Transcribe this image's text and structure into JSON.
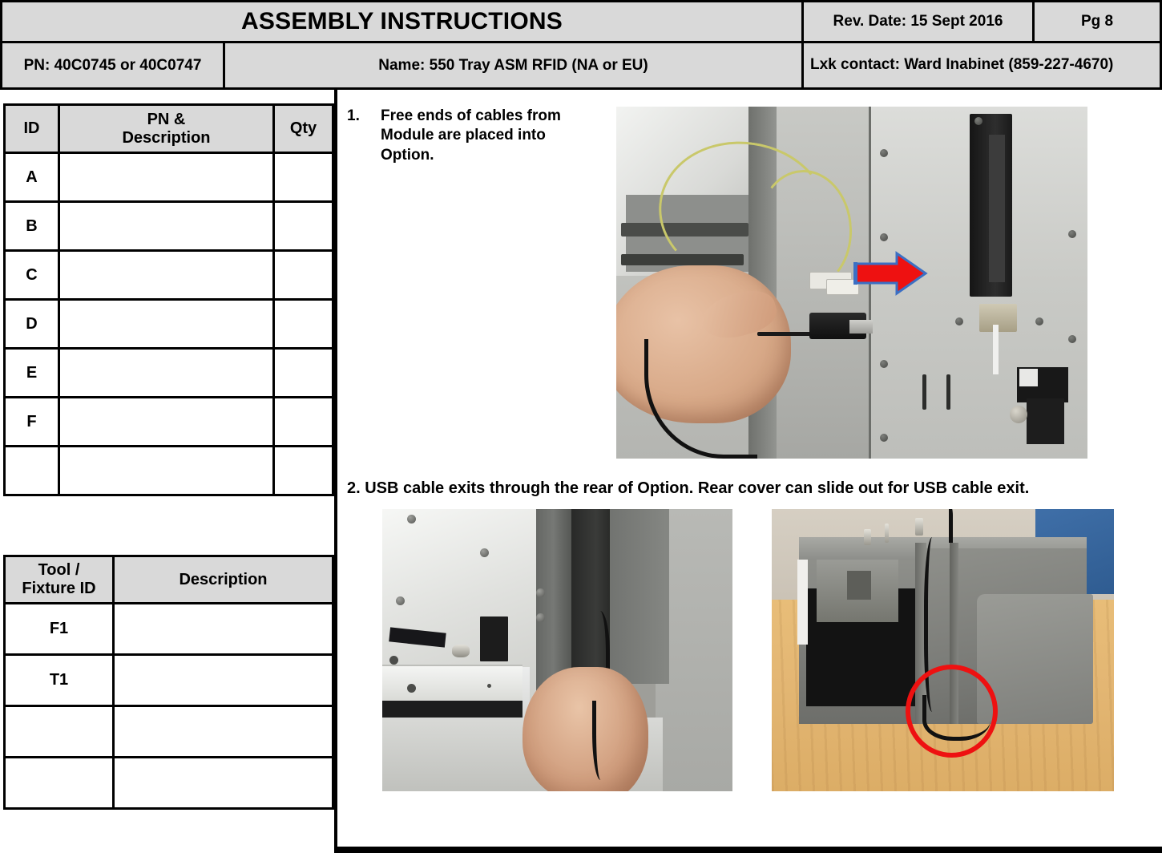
{
  "header": {
    "title": "ASSEMBLY INSTRUCTIONS",
    "rev_date": "Rev. Date: 15 Sept 2016",
    "page": "Pg  8",
    "pn": "PN:  40C0745 or 40C0747",
    "name": "Name:  550 Tray ASM RFID (NA or EU)",
    "contact": "Lxk contact: Ward Inabinet (859-227-4670)"
  },
  "parts_table": {
    "columns": [
      "ID",
      "PN & Description",
      "Qty"
    ],
    "col_id": "ID",
    "col_desc_line1": "PN &",
    "col_desc_line2": "Description",
    "col_qty": "Qty",
    "rows": [
      {
        "id": "A",
        "description": "",
        "qty": ""
      },
      {
        "id": "B",
        "description": "",
        "qty": ""
      },
      {
        "id": "C",
        "description": "",
        "qty": ""
      },
      {
        "id": "D",
        "description": "",
        "qty": ""
      },
      {
        "id": "E",
        "description": "",
        "qty": ""
      },
      {
        "id": "F",
        "description": "",
        "qty": ""
      },
      {
        "id": "",
        "description": "",
        "qty": ""
      }
    ]
  },
  "tool_table": {
    "col_tool_line1": "Tool /",
    "col_tool_line2": "Fixture ID",
    "col_description": "Description",
    "rows": [
      {
        "id": "F1",
        "description": ""
      },
      {
        "id": "T1",
        "description": ""
      },
      {
        "id": "",
        "description": ""
      },
      {
        "id": "",
        "description": ""
      }
    ]
  },
  "steps": [
    {
      "number": "1.",
      "text": "Free ends of cables from Module are placed into Option."
    },
    {
      "number": "2.",
      "text": "2. USB cable exits through the rear of Option.  Rear cover can slide out for USB cable exit."
    }
  ],
  "photos": {
    "photo1_caption": "Hand inserting USB cable toward printer option chassis with red arrow pointing right",
    "photo2_caption": "Hand routing black USB cable at rear cover of option",
    "photo3_caption": "Option tray on wooden desk with USB cable exiting rear, circled in red"
  },
  "colors": {
    "header_fill": "#d9d9d9",
    "border": "#000000",
    "annotation_red": "#ee1111",
    "annotation_blue": "#3b6fc4"
  }
}
